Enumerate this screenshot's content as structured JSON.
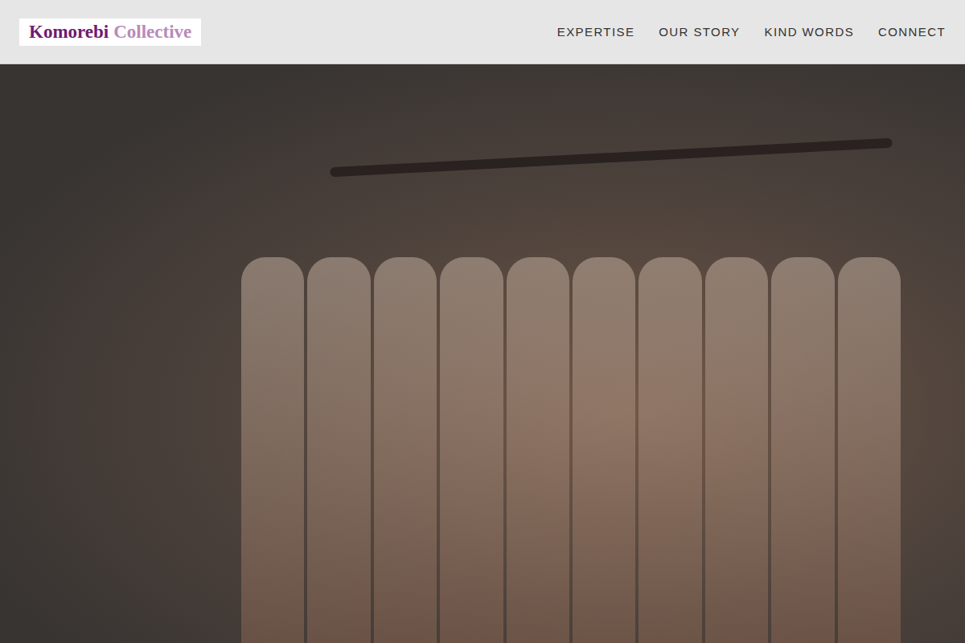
{
  "header": {
    "logo": {
      "primary": "Komorebi",
      "secondary": "Collective"
    },
    "nav": [
      {
        "label": "EXPERTISE"
      },
      {
        "label": "OUR STORY"
      },
      {
        "label": "KIND WORDS"
      },
      {
        "label": "CONNECT"
      }
    ]
  },
  "hero": {
    "image": "photo"
  }
}
